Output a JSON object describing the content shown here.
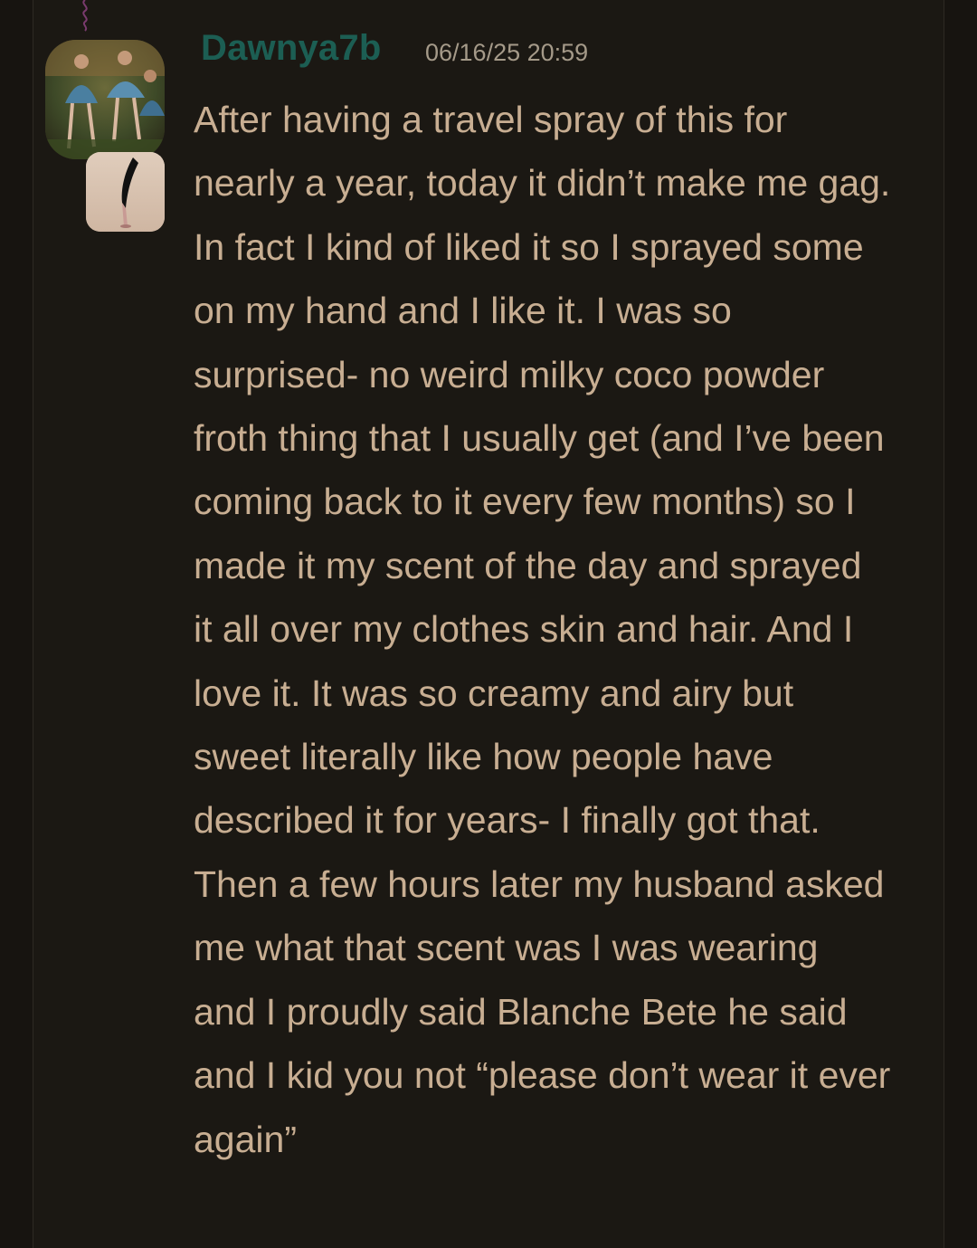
{
  "post": {
    "username": "Dawnya7b",
    "timestamp": "06/16/25 20:59",
    "avatar_icon": "painting-avatar-icon",
    "badge_icon": "high-heel-badge-icon",
    "comment_lines": [
      "After having a travel spray of this for",
      "nearly a year, today it didn’t make me gag.",
      "In fact I kind of liked it so I sprayed some",
      "on my hand and I like it. I was so",
      "surprised- no weird milky coco powder",
      "froth thing that I usually get (and I’ve been",
      "coming back to it every few months) so I",
      "made it my scent of the day and sprayed",
      "it all over my clothes skin and hair. And I",
      "love it. It was so creamy and airy but",
      "sweet literally like how people have",
      "described it for years- I finally got that.",
      "Then a few hours later my husband asked",
      "me what that scent was I was wearing",
      "and I proudly said Blanche Bete he said",
      "and I kid you not “please don’t wear it ever",
      "again”"
    ]
  },
  "colors": {
    "background": "#1b1813",
    "username": "#1c5e53",
    "timestamp": "#a59a89",
    "comment_text": "#c8ae92"
  }
}
